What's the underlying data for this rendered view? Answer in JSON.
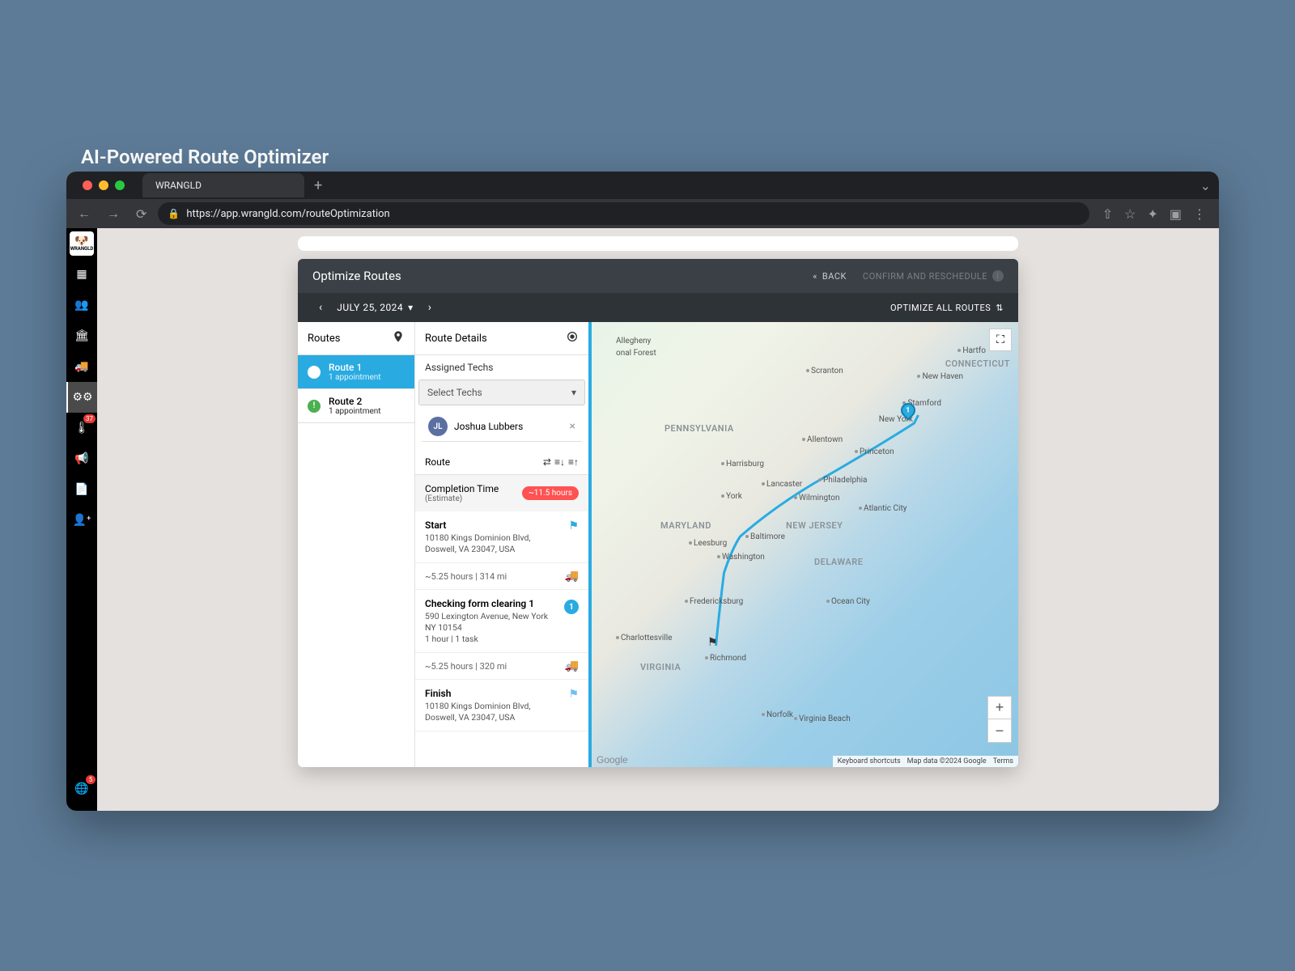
{
  "page": {
    "title": "AI-Powered Route Optimizer"
  },
  "browser": {
    "tab_title": "WRANGLD",
    "url": "https://app.wrangld.com/routeOptimization"
  },
  "sidebar": {
    "logo_text": "WRANGLD",
    "badges": {
      "thermometer": "37",
      "globe": "5"
    }
  },
  "modal": {
    "title": "Optimize Routes",
    "back_label": "BACK",
    "confirm_label": "CONFIRM AND RESCHEDULE",
    "date_label": "JULY 25, 2024",
    "optimize_all_label": "OPTIMIZE ALL ROUTES"
  },
  "routes": {
    "header": "Routes",
    "items": [
      {
        "name": "Route 1",
        "sub": "1 appointment",
        "selected": true,
        "dot": "white"
      },
      {
        "name": "Route 2",
        "sub": "1 appointment",
        "selected": false,
        "dot": "green",
        "dot_label": "!"
      }
    ]
  },
  "details": {
    "header": "Route Details",
    "assigned_label": "Assigned Techs",
    "select_placeholder": "Select Techs",
    "tech": {
      "initials": "JL",
      "name": "Joshua Lubbers"
    },
    "route_label": "Route",
    "completion": {
      "title": "Completion Time",
      "sub": "(Estimate)",
      "badge": "~11.5 hours"
    },
    "start": {
      "label": "Start",
      "addr1": "10180 Kings Dominion Blvd,",
      "addr2": "Doswell, VA 23047, USA"
    },
    "leg1": "~5.25 hours | 314 mi",
    "stop1": {
      "title": "Checking form clearing 1",
      "addr1": "590 Lexington Avenue, New York",
      "addr2": "NY 10154",
      "meta": "1 hour | 1 task",
      "num": "1"
    },
    "leg2": "~5.25 hours | 320 mi",
    "finish": {
      "label": "Finish",
      "addr1": "10180 Kings Dominion Blvd,",
      "addr2": "Doswell, VA 23047, USA"
    }
  },
  "map": {
    "states": {
      "pennsylvania": "PENNSYLVANIA",
      "connecticut": "CONNECTICUT",
      "maryland": "MARYLAND",
      "newjersey": "NEW JERSEY",
      "delaware": "DELAWARE",
      "virginia": "VIRGINIA"
    },
    "cities": {
      "hartford": "Hartfo",
      "newhaven": "New Haven",
      "scranton": "Scranton",
      "stamford": "Stamford",
      "newyork": "New York",
      "allentown": "Allentown",
      "princeton": "Princeton",
      "harrisburg": "Harrisburg",
      "lancaster": "Lancaster",
      "york": "York",
      "philadelphia": "Philadelphia",
      "wilmington": "Wilmington",
      "leesburg": "Leesburg",
      "baltimore": "Baltimore",
      "washington": "Washington",
      "atlanticcity": "Atlantic City",
      "fredericksburg": "Fredericksburg",
      "oceancity": "Ocean City",
      "charlottesville": "Charlottesville",
      "richmond": "Richmond",
      "norfolk": "Norfolk",
      "vabeach": "Virginia Beach",
      "allegheny": "Allegheny",
      "forest": "onal Forest"
    },
    "attrib": {
      "shortcuts": "Keyboard shortcuts",
      "data": "Map data ©2024 Google",
      "terms": "Terms"
    },
    "google": "Google"
  }
}
